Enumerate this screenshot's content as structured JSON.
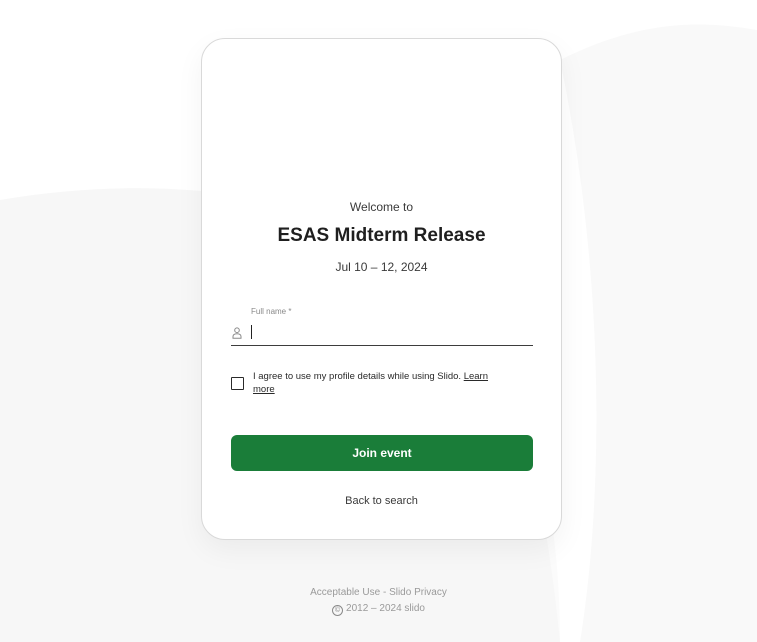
{
  "event": {
    "welcome": "Welcome to",
    "title": "ESAS Midterm Release",
    "date": "Jul 10 – 12, 2024"
  },
  "form": {
    "name_label": "Full name *",
    "name_value": "",
    "consent_text": "I agree to use my profile details while using Slido.",
    "learn_more": "Learn more",
    "join_label": "Join event",
    "back_label": "Back to search"
  },
  "footer": {
    "acceptable_use": "Acceptable Use",
    "separator": " - ",
    "privacy": "Slido Privacy",
    "copyright": "2012 – 2024 slido"
  },
  "colors": {
    "primary": "#1a7d39",
    "text": "#1f1f1f",
    "muted": "#9a9a9a"
  },
  "icons": {
    "name_field": "user-icon",
    "copyright": "copyright-icon"
  }
}
